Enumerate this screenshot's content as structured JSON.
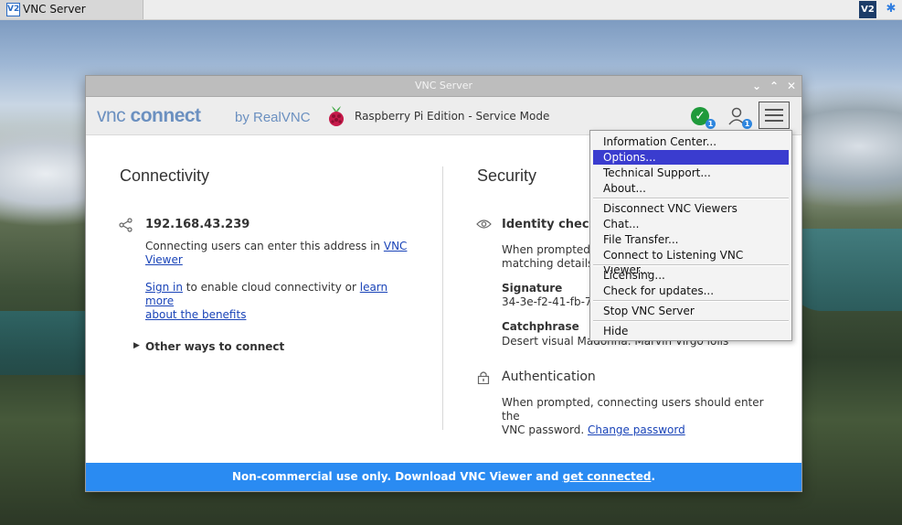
{
  "taskbar": {
    "app_label": "VNC Server",
    "app_icon": "V2",
    "tray_icon": "V2",
    "bluetooth_icon": "✱"
  },
  "window": {
    "title": "VNC Server",
    "buttons": {
      "collapse": "⌄",
      "maximize": "⌃",
      "close": "✕"
    }
  },
  "header": {
    "logo_vnc": "vnc",
    "logo_connect": "connect",
    "logo_by": "by RealVNC",
    "edition": "Raspberry Pi Edition - Service Mode",
    "status_check": "✓",
    "status_badge": "1",
    "users_badge": "1"
  },
  "connectivity": {
    "title": "Connectivity",
    "address": "192.168.43.239",
    "address_help_prefix": "Connecting users can enter this address in ",
    "address_help_link1": "VNC",
    "address_help_link2": "Viewer",
    "signin_link": "Sign in",
    "signin_middle": " to enable cloud connectivity or ",
    "learn_more_link1": "learn more",
    "learn_more_link2": "about the benefits",
    "other_ways": "Other ways to connect"
  },
  "security": {
    "title": "Security",
    "identity_title": "Identity check",
    "identity_text1": "When prompted,",
    "identity_text2": "matching details",
    "signature_label": "Signature",
    "signature_value": "34-3e-f2-41-fb-7",
    "catchphrase_label": "Catchphrase",
    "catchphrase_value": "Desert visual Madonna. Marvin Virgo lolls",
    "auth_title": "Authentication",
    "auth_text1": "When prompted, connecting users should enter the",
    "auth_text2": "VNC password. ",
    "change_password_link": "Change password"
  },
  "menu": {
    "items": [
      "Information Center...",
      "Options...",
      "Technical Support...",
      "About...",
      "Disconnect VNC Viewers",
      "Chat...",
      "File Transfer...",
      "Connect to Listening VNC Viewer...",
      "Licensing...",
      "Check for updates...",
      "Stop VNC Server",
      "Hide"
    ],
    "selected_index": 1
  },
  "footer": {
    "text": "Non-commercial use only. Download VNC Viewer and ",
    "link": "get connected",
    "suffix": "."
  },
  "colors": {
    "accent": "#2a8bf2",
    "menu_highlight": "#3a3ccf",
    "status_ok": "#1f9a3b",
    "link": "#1a44b8"
  }
}
